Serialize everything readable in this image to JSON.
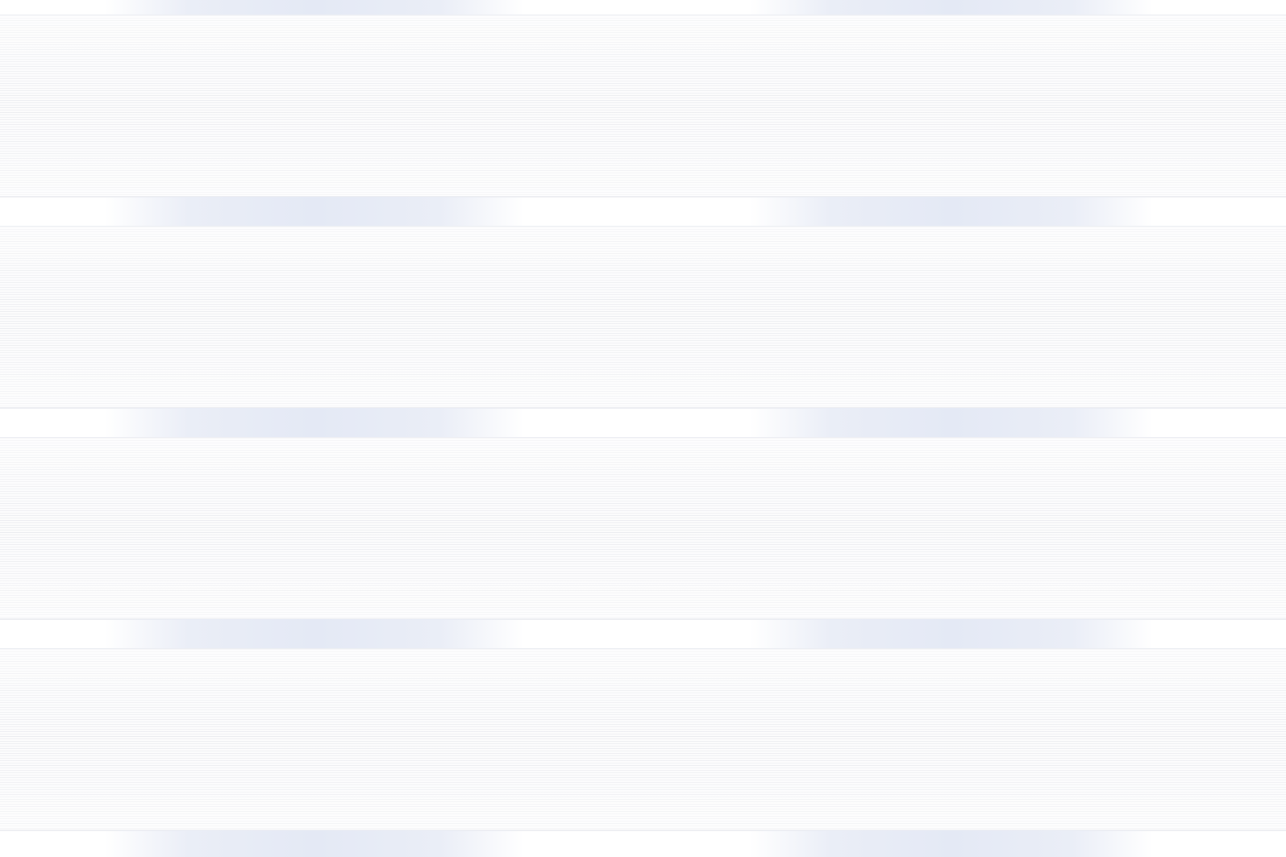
{
  "page": {
    "background": "#ffffff",
    "band_line_color": "#dee0e6",
    "strip_color": "#e4e9f5",
    "band_count": 4
  }
}
